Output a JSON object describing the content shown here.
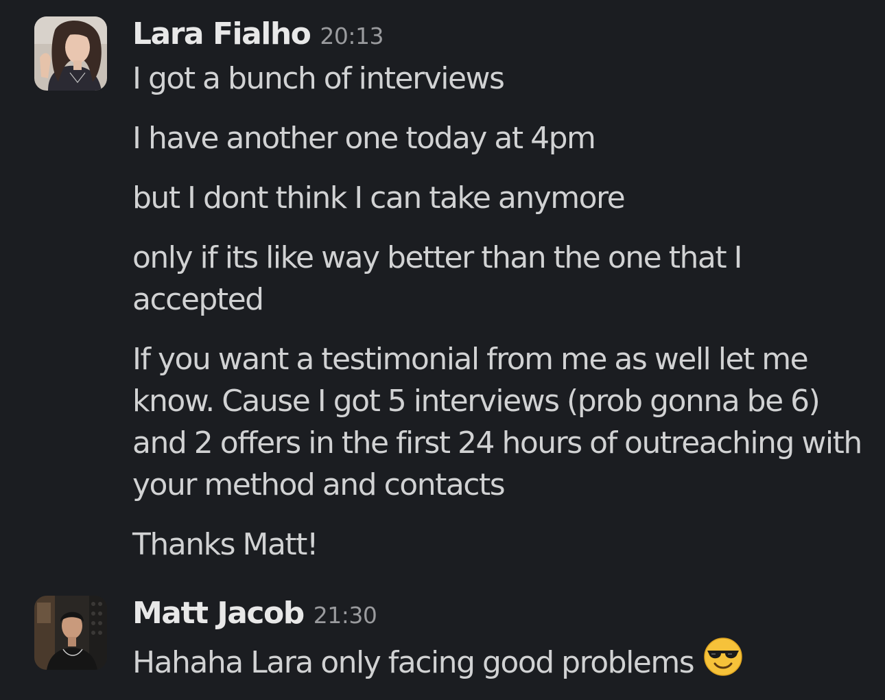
{
  "messages": [
    {
      "author": "Lara Fialho",
      "time": "20:13",
      "avatar": "lara-avatar",
      "lines": [
        "I got a bunch of interviews",
        "I have another one today at 4pm",
        "but I dont think I can take anymore",
        "only if its like way better than the one that I accepted",
        "If you want a testimonial from me as well let me know. Cause I got 5 interviews (prob gonna be 6) and 2 offers in the first 24 hours of outreaching with your method and contacts",
        "Thanks Matt!"
      ]
    },
    {
      "author": "Matt Jacob",
      "time": "21:30",
      "avatar": "matt-avatar",
      "lines": [
        "Hahaha Lara only facing good problems"
      ],
      "emoji": "smiling-face-with-sunglasses-icon"
    }
  ],
  "colors": {
    "background": "#1b1d21",
    "text": "#d1d2d3",
    "author": "#e8e8e8",
    "timestamp": "#9a9b9e"
  }
}
